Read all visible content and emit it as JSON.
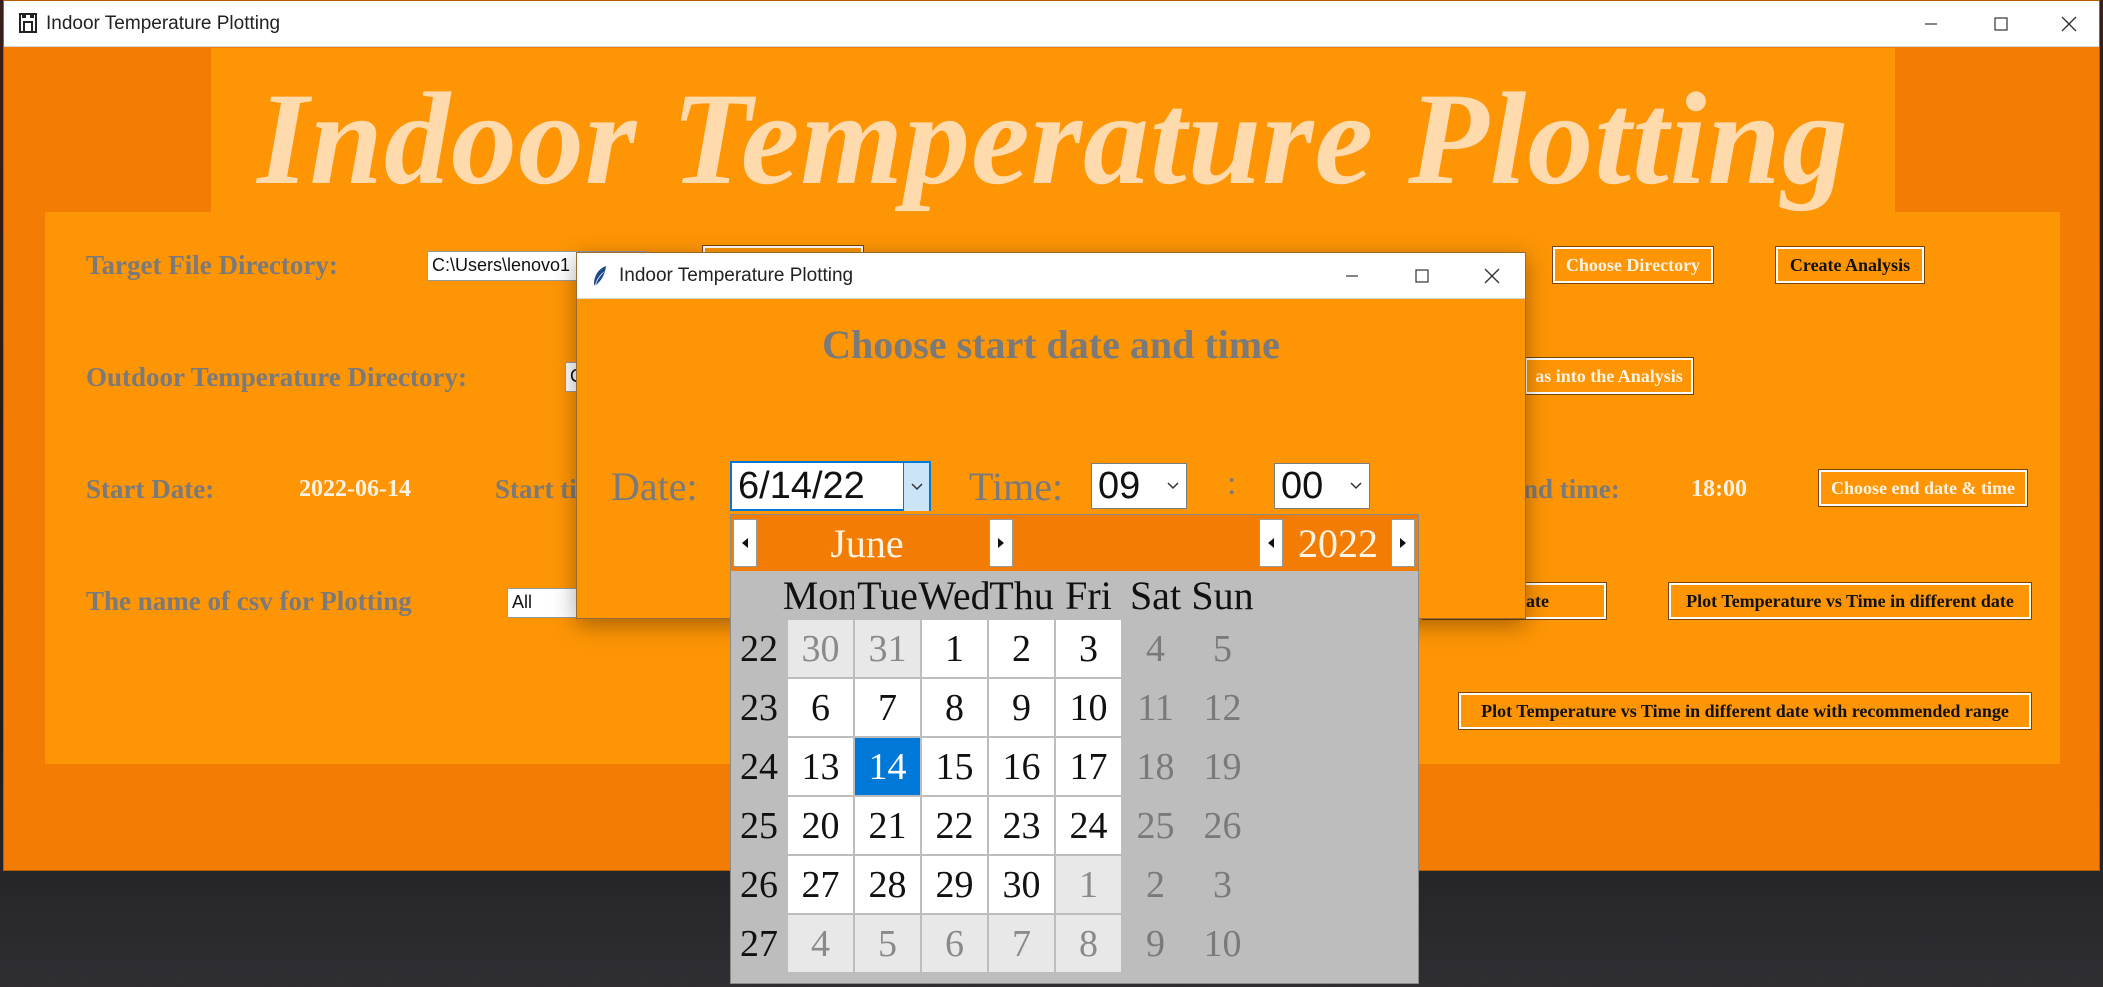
{
  "main": {
    "title": "Indoor Temperature Plotting",
    "banner_title": "Indoor Temperature Plotting",
    "target_label": "Target File Directory:",
    "target_value": "C:\\Users\\lenovo1",
    "outdoor_label": "Outdoor Temperature Directory:",
    "outdoor_value": "C",
    "start_date_label": "Start Date:",
    "start_date_value": "2022-06-14",
    "start_time_label": "Start ti",
    "end_time_label": "nd time:",
    "end_time_value": "18:00",
    "csv_label": "The name of csv for Plotting",
    "csv_value": "All",
    "choose_directory_button": "Choose Directory",
    "create_analysis_button": "Create Analysis",
    "into_analysis_button": "as into the Analysis",
    "choose_end_button": "Choose end date & time",
    "vs_date_button": "e vs Date",
    "plot_diff_button": "Plot Temperature vs Time in different date",
    "plot_range_button": "Plot Temperature vs Time in different date with recommended range"
  },
  "dialog": {
    "title": "Indoor Temperature Plotting",
    "heading": "Choose start date and time",
    "date_label": "Date:",
    "date_value": "6/14/22",
    "time_label": "Time:",
    "hour_value": "09",
    "colon": ":",
    "minute_value": "00"
  },
  "calendar": {
    "month": "June",
    "year": "2022",
    "day_names": [
      "Mon",
      "Tue",
      "Wed",
      "Thu",
      "Fri",
      "Sat",
      "Sun"
    ],
    "weeks": [
      {
        "week": "22",
        "days": [
          "30",
          "31",
          "1",
          "2",
          "3",
          "4",
          "5"
        ],
        "kinds": [
          "o",
          "o",
          "c",
          "c",
          "c",
          "w",
          "w"
        ]
      },
      {
        "week": "23",
        "days": [
          "6",
          "7",
          "8",
          "9",
          "10",
          "11",
          "12"
        ],
        "kinds": [
          "c",
          "c",
          "c",
          "c",
          "c",
          "w",
          "w"
        ]
      },
      {
        "week": "24",
        "days": [
          "13",
          "14",
          "15",
          "16",
          "17",
          "18",
          "19"
        ],
        "kinds": [
          "c",
          "s",
          "c",
          "c",
          "c",
          "w",
          "w"
        ]
      },
      {
        "week": "25",
        "days": [
          "20",
          "21",
          "22",
          "23",
          "24",
          "25",
          "26"
        ],
        "kinds": [
          "c",
          "c",
          "c",
          "c",
          "c",
          "w",
          "w"
        ]
      },
      {
        "week": "26",
        "days": [
          "27",
          "28",
          "29",
          "30",
          "1",
          "2",
          "3"
        ],
        "kinds": [
          "c",
          "c",
          "c",
          "c",
          "o",
          "w",
          "w"
        ]
      },
      {
        "week": "27",
        "days": [
          "4",
          "5",
          "6",
          "7",
          "8",
          "9",
          "10"
        ],
        "kinds": [
          "o",
          "o",
          "o",
          "o",
          "o",
          "w",
          "w"
        ]
      }
    ],
    "selected": "14"
  },
  "colors": {
    "window_bg": "#f27c04",
    "panel_bg": "#fe9505",
    "selected_day": "#0078d7"
  },
  "icons": {
    "app_icon": "castle-icon",
    "dialog_icon": "feather-icon",
    "minimize": "minimize-icon",
    "maximize": "maximize-icon",
    "close": "close-icon"
  }
}
